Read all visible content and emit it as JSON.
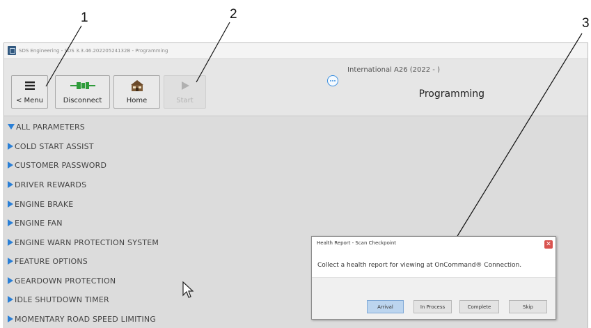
{
  "callouts": [
    "1",
    "2",
    "3"
  ],
  "window": {
    "title": "SDS Engineering - SDS 3.3.46.20220524132B - Programming",
    "vehicle": "International A26 (2022 - )",
    "page_title": "Programming"
  },
  "toolbar": {
    "menu_label": "< Menu",
    "disconnect_label": "Disconnect",
    "home_label": "Home",
    "start_label": "Start",
    "start_enabled": false
  },
  "parameters": [
    {
      "label": "ALL PARAMETERS",
      "expanded": true
    },
    {
      "label": "COLD START ASSIST",
      "expanded": false
    },
    {
      "label": "CUSTOMER PASSWORD",
      "expanded": false
    },
    {
      "label": "DRIVER REWARDS",
      "expanded": false
    },
    {
      "label": "ENGINE BRAKE",
      "expanded": false
    },
    {
      "label": "ENGINE FAN",
      "expanded": false
    },
    {
      "label": "ENGINE WARN PROTECTION SYSTEM",
      "expanded": false
    },
    {
      "label": "FEATURE OPTIONS",
      "expanded": false
    },
    {
      "label": "GEARDOWN PROTECTION",
      "expanded": false
    },
    {
      "label": "IDLE SHUTDOWN TIMER",
      "expanded": false
    },
    {
      "label": "MOMENTARY ROAD SPEED LIMITING",
      "expanded": false
    }
  ],
  "dialog": {
    "title": "Health Report - Scan Checkpoint",
    "message": "Collect a health report for viewing at OnCommand® Connection.",
    "buttons": [
      "Arrival",
      "In Process",
      "Complete",
      "Skip"
    ],
    "active_button": "Arrival"
  },
  "colors": {
    "accent": "#2a7fd6",
    "background": "#dcdcdc",
    "close": "#d9534f",
    "active_button": "#bcd5ef"
  },
  "icons": [
    "menu-icon",
    "disconnect-plug-icon",
    "home-icon",
    "play-icon",
    "more-icon",
    "close-icon",
    "mouse-cursor-icon"
  ]
}
